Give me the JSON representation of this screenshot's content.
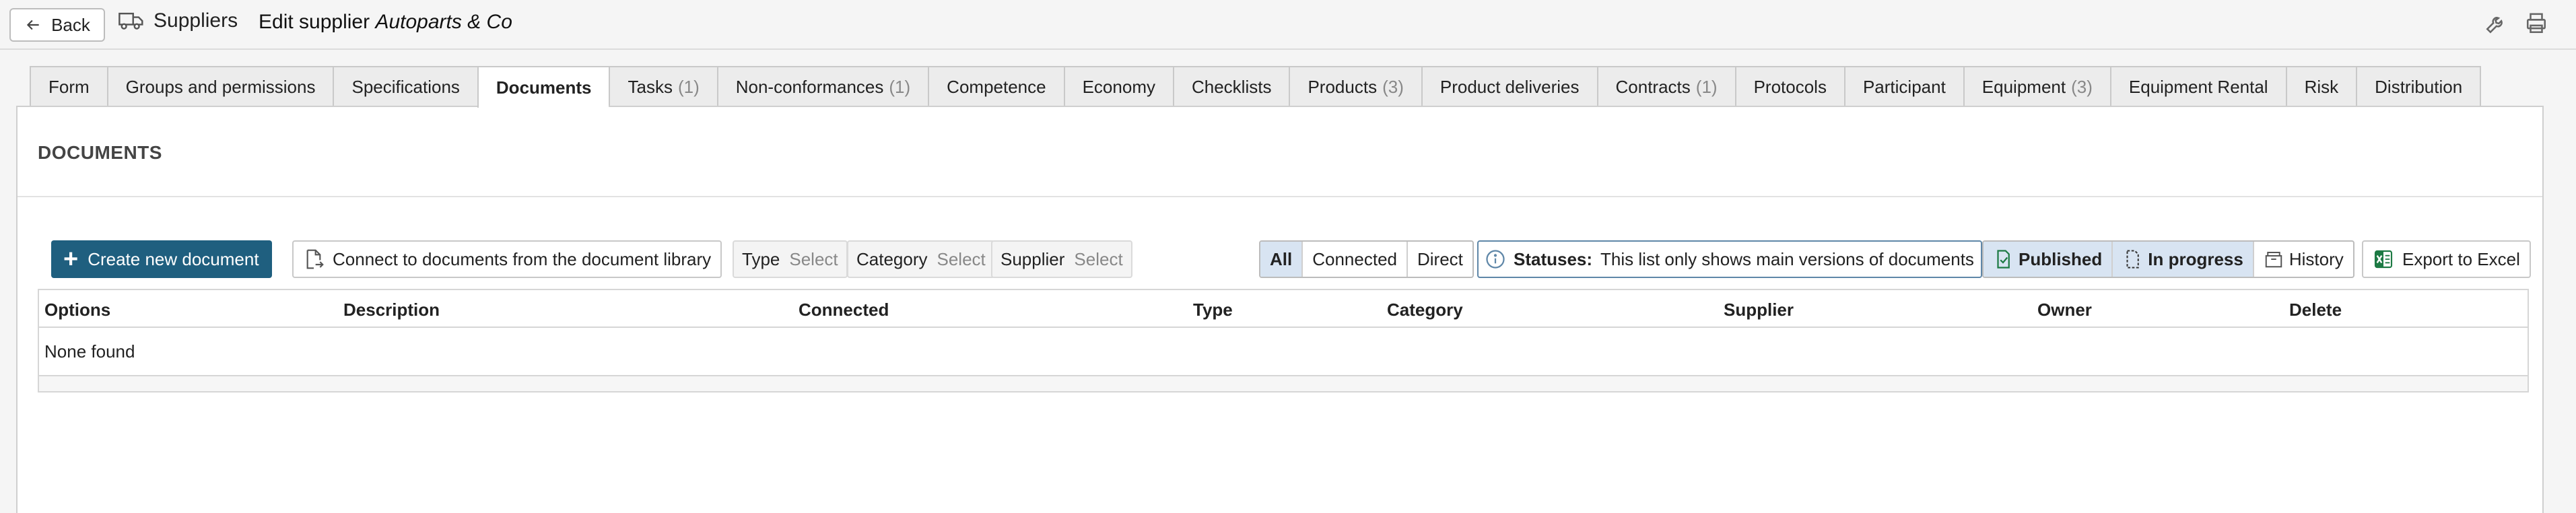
{
  "header": {
    "back_label": "Back",
    "breadcrumb": "Suppliers",
    "title_prefix": "Edit supplier",
    "title_name": "Autoparts & Co"
  },
  "tabs": [
    {
      "label": "Form",
      "count": ""
    },
    {
      "label": "Groups and permissions",
      "count": ""
    },
    {
      "label": "Specifications",
      "count": ""
    },
    {
      "label": "Documents",
      "count": "",
      "active": true
    },
    {
      "label": "Tasks",
      "count": "(1)"
    },
    {
      "label": "Non-conformances",
      "count": "(1)"
    },
    {
      "label": "Competence",
      "count": ""
    },
    {
      "label": "Economy",
      "count": ""
    },
    {
      "label": "Checklists",
      "count": ""
    },
    {
      "label": "Products",
      "count": "(3)"
    },
    {
      "label": "Product deliveries",
      "count": ""
    },
    {
      "label": "Contracts",
      "count": "(1)"
    },
    {
      "label": "Protocols",
      "count": ""
    },
    {
      "label": "Participant",
      "count": ""
    },
    {
      "label": "Equipment",
      "count": "(3)"
    },
    {
      "label": "Equipment Rental",
      "count": ""
    },
    {
      "label": "Risk",
      "count": ""
    },
    {
      "label": "Distribution",
      "count": ""
    }
  ],
  "section": {
    "title": "DOCUMENTS"
  },
  "toolbar": {
    "create_label": "Create new document",
    "connect_label": "Connect to documents from the document library",
    "filters": [
      {
        "label": "Type",
        "placeholder": "Select"
      },
      {
        "label": "Category",
        "placeholder": "Select"
      },
      {
        "label": "Supplier",
        "placeholder": "Select"
      }
    ],
    "scope": {
      "all": "All",
      "connected": "Connected",
      "direct": "Direct"
    },
    "statuses_label": "Statuses:",
    "statuses_text": "This list only shows main versions of documents",
    "status_toggle": {
      "published": "Published",
      "in_progress": "In progress",
      "history": "History"
    },
    "export_label": "Export to Excel"
  },
  "table": {
    "columns": [
      "Options",
      "Description",
      "Connected",
      "Type",
      "Category",
      "Supplier",
      "Owner",
      "Delete"
    ],
    "empty_text": "None found"
  },
  "colors": {
    "primary": "#1f5f7f",
    "selected": "#d8e4f2",
    "excel": "#1d7a44"
  }
}
